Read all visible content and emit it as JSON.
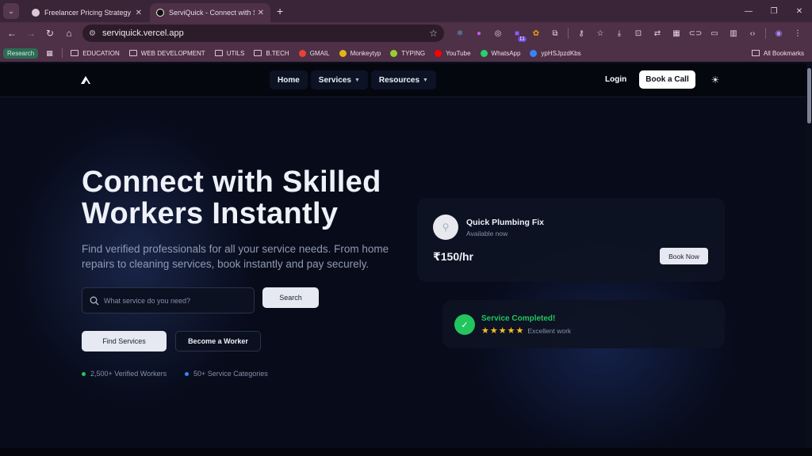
{
  "browser": {
    "tabs": [
      {
        "title": "Freelancer Pricing Strategy",
        "active": false
      },
      {
        "title": "ServiQuick - Connect with Skille",
        "active": true
      }
    ],
    "url": "serviquick.vercel.app",
    "extension_badge": "11",
    "bookmarks": [
      {
        "label": "EDUCATION"
      },
      {
        "label": "WEB DEVELOPMENT"
      },
      {
        "label": "UTILS"
      },
      {
        "label": "B.TECH"
      },
      {
        "label": "GMAIL"
      },
      {
        "label": "Monkeytyp"
      },
      {
        "label": "TYPING"
      },
      {
        "label": "YouTube"
      },
      {
        "label": "WhatsApp"
      },
      {
        "label": "ypHSJpzdKbs"
      }
    ],
    "research_label": "Research",
    "all_bookmarks": "All Bookmarks"
  },
  "site": {
    "nav": {
      "home": "Home",
      "services": "Services",
      "resources": "Resources",
      "login": "Login",
      "book_call": "Book a Call"
    },
    "hero": {
      "title_line1": "Connect with Skilled",
      "title_line2": "Workers Instantly",
      "subtitle": "Find verified professionals for all your service needs. From home repairs to cleaning services, book instantly and pay securely.",
      "search_placeholder": "What service do you need?",
      "search_button": "Search",
      "find_services": "Find Services",
      "become_worker": "Become a Worker",
      "stats": [
        {
          "text": "2,500+ Verified Workers",
          "color": "#22c55e"
        },
        {
          "text": "50+ Service Categories",
          "color": "#3b82f6"
        }
      ]
    },
    "card_service": {
      "title": "Quick Plumbing Fix",
      "status": "Available now",
      "price": "₹150/hr",
      "button": "Book Now"
    },
    "card_completed": {
      "title": "Service Completed!",
      "rating": 5,
      "review": "Excellent work"
    }
  }
}
